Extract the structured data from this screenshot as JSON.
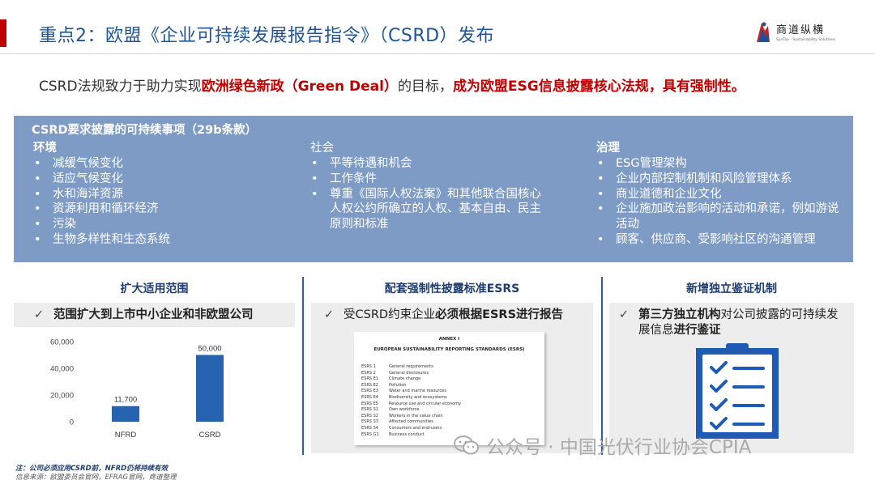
{
  "header": {
    "title": "重点2：欧盟《企业可持续发展报告指令》（CSRD）发布",
    "logo_cn": "商道纵横",
    "logo_en": "SynTao - Sustainability Solutions"
  },
  "intro": {
    "part1": "CSRD法规致力于助力实现",
    "part2": "欧洲绿色新政（Green  Deal）",
    "part3": "的目标，",
    "part4": "成为欧盟ESG信息披露核心法规，具有强制性。"
  },
  "banner": {
    "title": "CSRD要求披露的可持续事项（29b条款）",
    "environment": {
      "head": "环境",
      "items": [
        "减缓气候变化",
        "适应气候变化",
        "水和海洋资源",
        "资源利用和循环经济",
        "污染",
        "生物多样性和生态系统"
      ]
    },
    "social": {
      "head": "社会",
      "items": [
        "平等待遇和机会",
        "工作条件",
        "尊重《国际人权法案》和其他联合国核心人权公约所确立的人权、基本自由、民主原则和标准"
      ]
    },
    "governance": {
      "head": "治理",
      "items": [
        "ESG管理架构",
        "企业内部控制机制和风险管理体系",
        "商业道德和企业文化",
        "企业施加政治影响的活动和承诺，例如游说活动",
        "顾客、供应商、受影响社区的沟通管理"
      ]
    }
  },
  "panels": {
    "scope": {
      "head": "扩大适用范围",
      "check": "✓",
      "text": "范围扩大到上市中小企业和非欧盟公司"
    },
    "esrs": {
      "head": "配套强制性披露标准ESRS",
      "check": "✓",
      "text_plain": "受CSRD约束企业",
      "text_bold": "必须根据ESRS进行报告"
    },
    "assurance": {
      "head": "新增独立鉴证机制",
      "check": "✓",
      "bold1": "第三方独立机构",
      "plain": "对公司披露的可持续发展信息",
      "bold2": "进行鉴证"
    }
  },
  "chart_data": {
    "type": "bar",
    "categories": [
      "NFRD",
      "CSRD"
    ],
    "values": [
      11700,
      50000
    ],
    "value_labels": [
      "11,700",
      "50,000"
    ],
    "yticks": [
      "0",
      "20,000",
      "40,000",
      "60,000"
    ],
    "ylim": [
      0,
      60000
    ],
    "bar_color": "#2563b0",
    "title": "",
    "xlabel": "",
    "ylabel": ""
  },
  "annex": {
    "heading": "ANNEX I",
    "subheading": "EUROPEAN SUSTAINABILITY REPORTING STANDARDS (ESRS)",
    "rows": [
      {
        "code": "ESRS 1",
        "name": "General requirements"
      },
      {
        "code": "ESRS 2",
        "name": "General disclosures"
      },
      {
        "code": "ESRS E1",
        "name": "Climate change"
      },
      {
        "code": "ESRS E2",
        "name": "Pollution"
      },
      {
        "code": "ESRS E3",
        "name": "Water and marine resources"
      },
      {
        "code": "ESRS E4",
        "name": "Biodiversity and ecosystems"
      },
      {
        "code": "ESRS E5",
        "name": "Resource use and circular economy"
      },
      {
        "code": "ESRS S1",
        "name": "Own workforce"
      },
      {
        "code": "ESRS S2",
        "name": "Workers in the value chain"
      },
      {
        "code": "ESRS S3",
        "name": "Affected communities"
      },
      {
        "code": "ESRS S4",
        "name": "Consumers and end-users"
      },
      {
        "code": "ESRS G1",
        "name": "Business conduct"
      }
    ]
  },
  "watermark": "公众号 · 中国光伏行业协会CPIA",
  "footnotes": {
    "note": "注：公司必须应用CSRD前，NFRD仍将持续有效",
    "source": "信息来源：欧盟委员会官网，EFRAG官网，商道整理"
  },
  "colors": {
    "title_blue": "#1f5597",
    "accent_red": "#c00000",
    "banner_blue": "#7d9bc4",
    "icon_blue": "#1f5bb5"
  }
}
